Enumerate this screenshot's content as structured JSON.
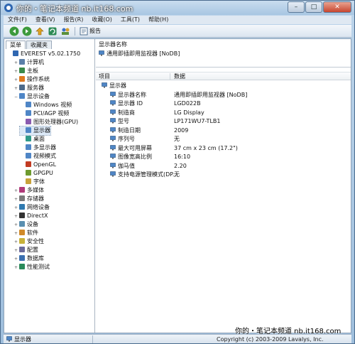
{
  "window": {
    "watermark_top": "你的・笔记本频道  nb.it168.com",
    "watermark_bottom": "你的・笔记本频道  nb.it168.com",
    "controls": {
      "minimize": "–",
      "maximize": "□",
      "close": "✕"
    }
  },
  "menu": [
    "文件(F)",
    "查看(V)",
    "报告(R)",
    "收藏(O)",
    "工具(T)",
    "帮助(H)"
  ],
  "toolbar": {
    "report_label": "报告"
  },
  "left_tabs": [
    "菜单",
    "收藏夹"
  ],
  "tree": [
    {
      "label": "EVEREST v5.02.1750",
      "level": 0,
      "exp": "",
      "icon": "everest-icon"
    },
    {
      "label": "计算机",
      "level": 1,
      "exp": "+",
      "icon": "computer-icon"
    },
    {
      "label": "主板",
      "level": 1,
      "exp": "+",
      "icon": "motherboard-icon"
    },
    {
      "label": "操作系统",
      "level": 1,
      "exp": "+",
      "icon": "os-icon"
    },
    {
      "label": "服务器",
      "level": 1,
      "exp": "+",
      "icon": "server-icon"
    },
    {
      "label": "显示设备",
      "level": 1,
      "exp": "−",
      "icon": "display-icon"
    },
    {
      "label": "Windows 视频",
      "level": 2,
      "exp": "",
      "icon": "monitor-icon"
    },
    {
      "label": "PCI/AGP 视频",
      "level": 2,
      "exp": "",
      "icon": "monitor-icon"
    },
    {
      "label": "图形处理器(GPU)",
      "level": 2,
      "exp": "",
      "icon": "gpu-icon"
    },
    {
      "label": "显示器",
      "level": 2,
      "exp": "",
      "icon": "monitor-icon",
      "selected": true
    },
    {
      "label": "桌面",
      "level": 2,
      "exp": "",
      "icon": "desktop-icon"
    },
    {
      "label": "多显示器",
      "level": 2,
      "exp": "",
      "icon": "monitor-icon"
    },
    {
      "label": "视频模式",
      "level": 2,
      "exp": "",
      "icon": "monitor-icon"
    },
    {
      "label": "OpenGL",
      "level": 2,
      "exp": "",
      "icon": "opengl-icon"
    },
    {
      "label": "GPGPU",
      "level": 2,
      "exp": "",
      "icon": "gpgpu-icon"
    },
    {
      "label": "字体",
      "level": 2,
      "exp": "",
      "icon": "font-icon"
    },
    {
      "label": "多媒体",
      "level": 1,
      "exp": "+",
      "icon": "multimedia-icon"
    },
    {
      "label": "存储器",
      "level": 1,
      "exp": "+",
      "icon": "storage-icon"
    },
    {
      "label": "网络设备",
      "level": 1,
      "exp": "+",
      "icon": "network-icon"
    },
    {
      "label": "DirectX",
      "level": 1,
      "exp": "+",
      "icon": "directx-icon"
    },
    {
      "label": "设备",
      "level": 1,
      "exp": "+",
      "icon": "devices-icon"
    },
    {
      "label": "软件",
      "level": 1,
      "exp": "+",
      "icon": "software-icon"
    },
    {
      "label": "安全性",
      "level": 1,
      "exp": "+",
      "icon": "security-icon"
    },
    {
      "label": "配置",
      "level": 1,
      "exp": "+",
      "icon": "config-icon"
    },
    {
      "label": "数据库",
      "level": 1,
      "exp": "+",
      "icon": "database-icon"
    },
    {
      "label": "性能测试",
      "level": 1,
      "exp": "+",
      "icon": "benchmark-icon"
    }
  ],
  "device_box": {
    "label": "显示器名称",
    "item": "通用即插即用监视器 [NoDB]"
  },
  "columns": {
    "item": "项目",
    "data": "数据"
  },
  "section": "显示器",
  "properties": [
    {
      "item": "显示器名称",
      "value": "通用即插即用监视器 [NoDB]"
    },
    {
      "item": "显示器 ID",
      "value": "LGD022B"
    },
    {
      "item": "制造商",
      "value": "LG Display"
    },
    {
      "item": "型号",
      "value": "LP171WU7-TLB1"
    },
    {
      "item": "制造日期",
      "value": "2009"
    },
    {
      "item": "序列号",
      "value": "无"
    },
    {
      "item": "最大可用屏幕",
      "value": "37 cm x 23 cm (17.2\")"
    },
    {
      "item": "图像宽高比例",
      "value": "16:10"
    },
    {
      "item": "伽马值",
      "value": "2.20"
    },
    {
      "item": "支持电源管理模式(DP...",
      "value": "无"
    }
  ],
  "status": {
    "left": "显示器",
    "right": "Copyright (c) 2003-2009 Lavalys, Inc."
  }
}
